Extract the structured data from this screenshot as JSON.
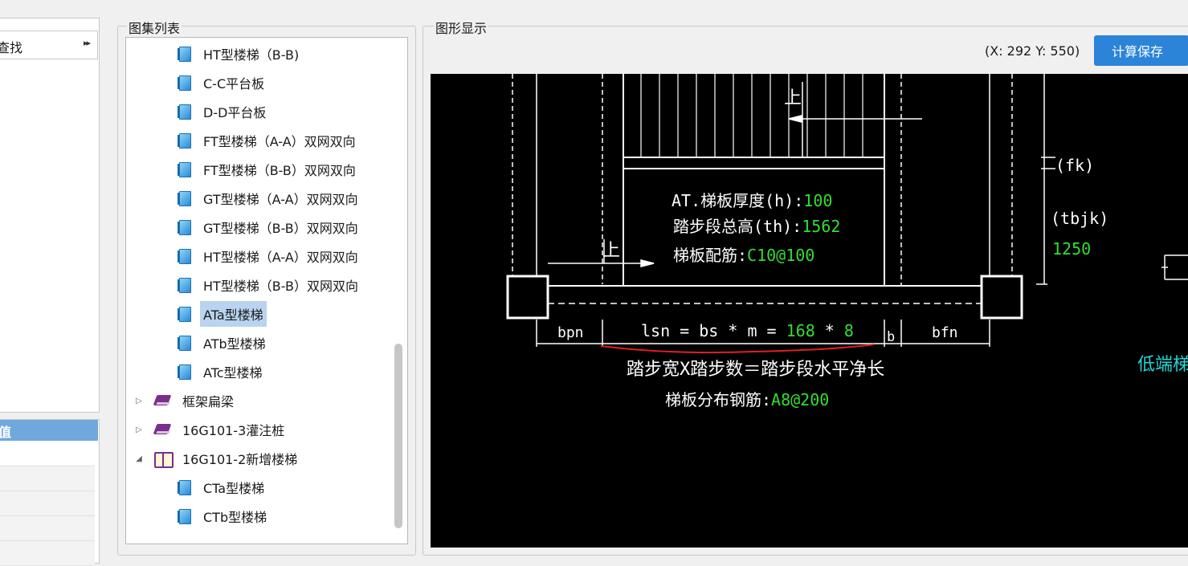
{
  "left_panel": {
    "search_label": "查找",
    "search_arrow": "▸▸",
    "props_header": "值"
  },
  "tree_group": {
    "title": "图集列表",
    "items": [
      {
        "label": "HT型楼梯（B-B)",
        "type": "doc",
        "level": 2
      },
      {
        "label": "C-C平台板",
        "type": "doc",
        "level": 2
      },
      {
        "label": "D-D平台板",
        "type": "doc",
        "level": 2
      },
      {
        "label": "FT型楼梯（A-A）双网双向",
        "type": "doc",
        "level": 2
      },
      {
        "label": "FT型楼梯（B-B）双网双向",
        "type": "doc",
        "level": 2
      },
      {
        "label": "GT型楼梯（A-A）双网双向",
        "type": "doc",
        "level": 2
      },
      {
        "label": "GT型楼梯（B-B）双网双向",
        "type": "doc",
        "level": 2
      },
      {
        "label": "HT型楼梯（A-A）双网双向",
        "type": "doc",
        "level": 2
      },
      {
        "label": "HT型楼梯（B-B）双网双向",
        "type": "doc",
        "level": 2
      },
      {
        "label": "ATa型楼梯",
        "type": "doc",
        "level": 2,
        "selected": true
      },
      {
        "label": "ATb型楼梯",
        "type": "doc",
        "level": 2
      },
      {
        "label": "ATc型楼梯",
        "type": "doc",
        "level": 2
      },
      {
        "label": "框架扁梁",
        "type": "book",
        "level": 1,
        "expander": "▷"
      },
      {
        "label": "16G101-3灌注桩",
        "type": "book",
        "level": 1,
        "expander": "▷"
      },
      {
        "label": "16G101-2新增楼梯",
        "type": "openbook",
        "level": 1,
        "expander": "◢"
      },
      {
        "label": "CTa型楼梯",
        "type": "doc",
        "level": 2
      },
      {
        "label": "CTb型楼梯",
        "type": "doc",
        "level": 2
      }
    ]
  },
  "graphic_group": {
    "title": "图形显示",
    "coord_text": "(X: 292 Y: 550)",
    "save_button": "计算保存"
  },
  "drawing": {
    "up_label_1": "上",
    "up_label_2": "上",
    "thickness_label": "AT.梯板厚度(h):",
    "thickness_value": "100",
    "height_label": "踏步段总高(th):",
    "height_value": "1562",
    "rebar_label": "梯板配筋:",
    "rebar_value": "C10@100",
    "fk_label": "(fk)",
    "tbjk_label": "(tbjk)",
    "tbjk_value": "1250",
    "bpn_label": "bpn",
    "lsn_prefix": "lsn = bs * m = ",
    "bs_value": "168",
    "times": "*",
    "m_value": "8",
    "b_label": "b",
    "bfn_label": "bfn",
    "formula_text": "踏步宽X踏步数＝踏步段水平净长",
    "dist_rebar_label": "梯板分布钢筋:",
    "dist_rebar_value": "A8@200",
    "low_end_label": "低端梯",
    "colors": {
      "canvas": "#000000",
      "line": "#ffffff",
      "value": "#33dd33",
      "cyan": "#22d8d8",
      "underline": "#e02020"
    }
  }
}
